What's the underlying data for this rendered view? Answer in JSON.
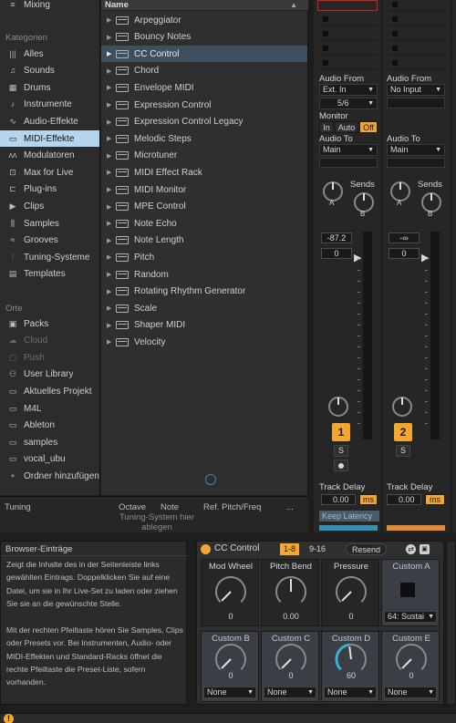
{
  "sidebar": {
    "top_item": "Mixing",
    "categories_heading": "Kategorien",
    "categories": [
      {
        "label": "Alles",
        "icon": "bars-icon"
      },
      {
        "label": "Sounds",
        "icon": "note-icon"
      },
      {
        "label": "Drums",
        "icon": "drum-grid-icon"
      },
      {
        "label": "Instrumente",
        "icon": "instrument-icon"
      },
      {
        "label": "Audio-Effekte",
        "icon": "waveform-icon"
      },
      {
        "label": "MIDI-Effekte",
        "icon": "midi-icon",
        "selected": true
      },
      {
        "label": "Modulatoren",
        "icon": "modulator-icon"
      },
      {
        "label": "Max for Live",
        "icon": "max-icon"
      },
      {
        "label": "Plug-ins",
        "icon": "plugin-icon"
      },
      {
        "label": "Clips",
        "icon": "clip-icon"
      },
      {
        "label": "Samples",
        "icon": "sample-icon"
      },
      {
        "label": "Grooves",
        "icon": "groove-icon"
      },
      {
        "label": "Tuning-Systeme",
        "icon": "tuning-icon"
      },
      {
        "label": "Templates",
        "icon": "template-icon"
      }
    ],
    "places_heading": "Orte",
    "places": [
      {
        "label": "Packs",
        "icon": "packs-icon"
      },
      {
        "label": "Cloud",
        "icon": "cloud-icon",
        "dim": true
      },
      {
        "label": "Push",
        "icon": "push-icon",
        "dim": true
      },
      {
        "label": "User Library",
        "icon": "user-icon"
      },
      {
        "label": "Aktuelles Projekt",
        "icon": "folder-icon"
      },
      {
        "label": "M4L",
        "icon": "folder-icon"
      },
      {
        "label": "Ableton",
        "icon": "folder-icon"
      },
      {
        "label": "samples",
        "icon": "folder-icon"
      },
      {
        "label": "vocal_ubu",
        "icon": "folder-icon"
      },
      {
        "label": "Ordner hinzufügen",
        "icon": "add-folder-icon"
      }
    ]
  },
  "browser": {
    "header": "Name",
    "items": [
      {
        "label": "Arpeggiator"
      },
      {
        "label": "Bouncy Notes"
      },
      {
        "label": "CC Control",
        "selected": true
      },
      {
        "label": "Chord"
      },
      {
        "label": "Envelope MIDI"
      },
      {
        "label": "Expression Control"
      },
      {
        "label": "Expression Control Legacy"
      },
      {
        "label": "Melodic Steps"
      },
      {
        "label": "Microtuner"
      },
      {
        "label": "MIDI Effect Rack"
      },
      {
        "label": "MIDI Monitor"
      },
      {
        "label": "MPE Control"
      },
      {
        "label": "Note Echo"
      },
      {
        "label": "Note Length"
      },
      {
        "label": "Pitch"
      },
      {
        "label": "Random"
      },
      {
        "label": "Rotating Rhythm Generator"
      },
      {
        "label": "Scale"
      },
      {
        "label": "Shaper MIDI"
      },
      {
        "label": "Velocity"
      }
    ]
  },
  "tuning": {
    "label": "Tuning",
    "octave": "Octave",
    "note": "Note",
    "ref": "Ref. Pitch/Freq",
    "more": "...",
    "message": "Tuning-System hier ablegen"
  },
  "mixer": {
    "audio_from": "Audio From",
    "monitor": "Monitor",
    "audio_to": "Audio To",
    "sends": "Sends",
    "track_delay": "Track Delay",
    "keep_latency": "Keep Latency",
    "tracks": [
      {
        "input_type": "Ext. In",
        "input_channel": "5/6",
        "monitor_in": "In",
        "monitor_auto": "Auto",
        "monitor_off": "Off",
        "output": "Main",
        "send_a": "A",
        "send_b": "B",
        "volume": "-87.2",
        "pan": "0",
        "number": "1",
        "solo": "S",
        "delay": "0.00",
        "delay_unit": "ms"
      },
      {
        "input_type": "No Input",
        "output": "Main",
        "send_a": "A",
        "send_b": "B",
        "volume": "-∞",
        "pan": "0",
        "number": "2",
        "solo": "S",
        "delay": "0.00",
        "delay_unit": "ms"
      }
    ]
  },
  "info": {
    "title": "Browser-Einträge",
    "paragraph1": "Zeigt die Inhalte des in der Seitenleiste links gewählten Eintrags. Doppelklicken Sie auf eine Datei, um sie in Ihr Live-Set zu laden oder ziehen Sie sie an die gewünschte Stelle.",
    "paragraph2": "Mit der rechten Pfeiltaste hören Sie Samples, Clips oder Presets vor. Bei Instrumenten, Audio- oder MIDI-Effekten und Standard-Racks öffnet die rechte Pfeiltaste die Preset-Liste, sofern vorhanden."
  },
  "device": {
    "name": "CC Control",
    "tab1": "1-8",
    "tab2": "9-16",
    "resend": "Resend",
    "params_row1": [
      {
        "name": "Mod Wheel",
        "value": "0"
      },
      {
        "name": "Pitch Bend",
        "value": "0.00"
      },
      {
        "name": "Pressure",
        "value": "0"
      },
      {
        "name": "Custom A",
        "value": "64: Sustai"
      }
    ],
    "params_row2": [
      {
        "name": "Custom B",
        "value": "0",
        "select": "None"
      },
      {
        "name": "Custom C",
        "value": "0",
        "select": "None"
      },
      {
        "name": "Custom D",
        "value": "60",
        "select": "None"
      },
      {
        "name": "Custom E",
        "value": "0",
        "select": "None"
      }
    ]
  },
  "colors": {
    "accent": "#f5a630",
    "selection": "#b6d5ec",
    "knob_active": "#3ab0d0"
  }
}
